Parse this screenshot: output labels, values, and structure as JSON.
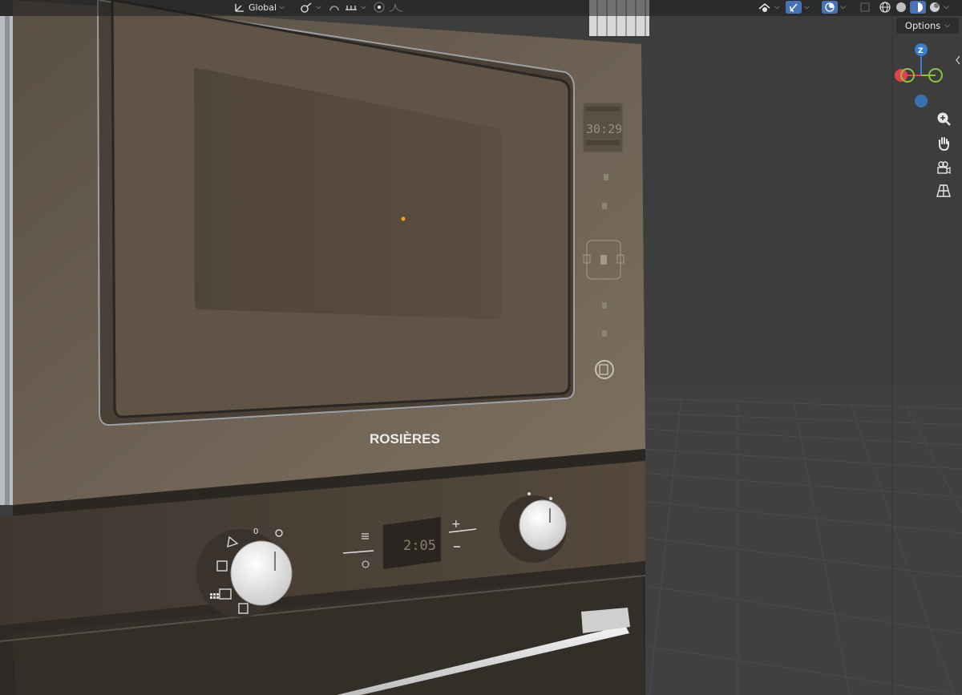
{
  "header": {
    "orientation_label": "Global",
    "options_label": "Options"
  },
  "gizmo": {
    "z_label": "Z"
  },
  "scene": {
    "brand": "ROSIÈRES",
    "micro_display": "30:29",
    "oven_display": "2:05",
    "knob_left_zero": "0",
    "plus_sign": "+",
    "minus_sign": "–"
  },
  "colors": {
    "active": "#4772b3",
    "x_axis": "#e3424d",
    "y_axis": "#8bc33b",
    "z_axis": "#3a7fce",
    "origin": "#f2a31b"
  },
  "icons": [
    "transform-orientation-icon",
    "pivot-icon",
    "snap-icon",
    "snap-increment-icon",
    "proportional-edit-icon",
    "falloff-icon",
    "visibility-icon",
    "gizmo-toggle-icon",
    "overlay-icon",
    "xray-icon",
    "wireframe-shading-icon",
    "solid-shading-icon",
    "material-shading-icon",
    "rendered-shading-icon",
    "zoom-icon",
    "hand-icon",
    "camera-icon",
    "grid-icon"
  ]
}
